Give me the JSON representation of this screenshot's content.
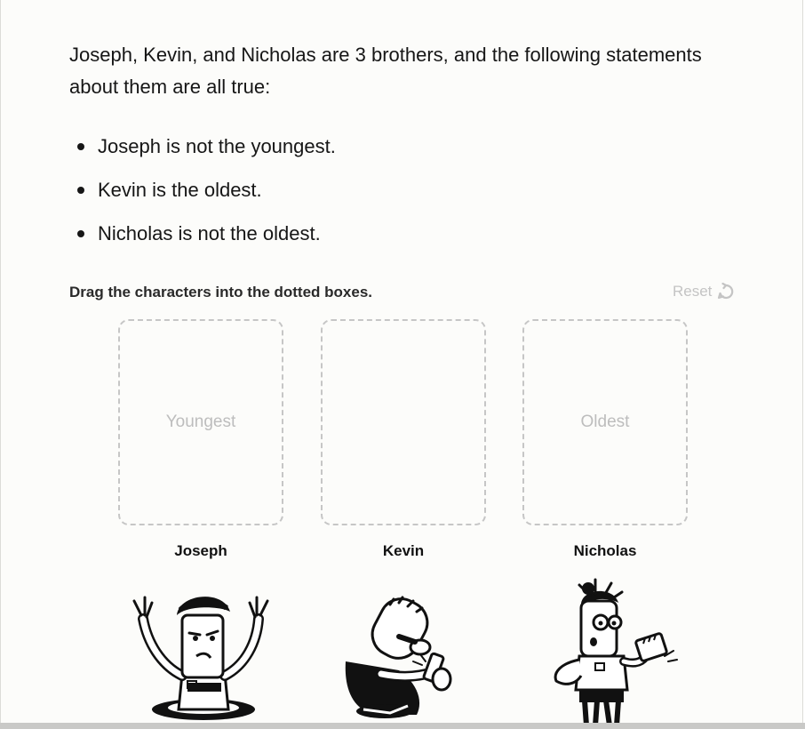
{
  "puzzle": {
    "intro": "Joseph, Kevin, and Nicholas are 3 brothers, and the following statements about them are all true:",
    "statements": [
      "Joseph is not the youngest.",
      "Kevin is the oldest.",
      "Nicholas is not the oldest."
    ]
  },
  "activity": {
    "instruction": "Drag the characters into the dotted boxes.",
    "reset_label": "Reset",
    "drop_boxes": [
      "Youngest",
      "",
      "Oldest"
    ]
  },
  "characters": [
    {
      "name": "Joseph",
      "icon": "joseph-character-icon"
    },
    {
      "name": "Kevin",
      "icon": "kevin-character-icon"
    },
    {
      "name": "Nicholas",
      "icon": "nicholas-character-icon"
    }
  ],
  "colors": {
    "background": "#fcfcfa",
    "text": "#161616",
    "placeholder": "#bdbdbd",
    "dashed_border": "#c6c6c6",
    "reset": "#c4c4c4"
  }
}
